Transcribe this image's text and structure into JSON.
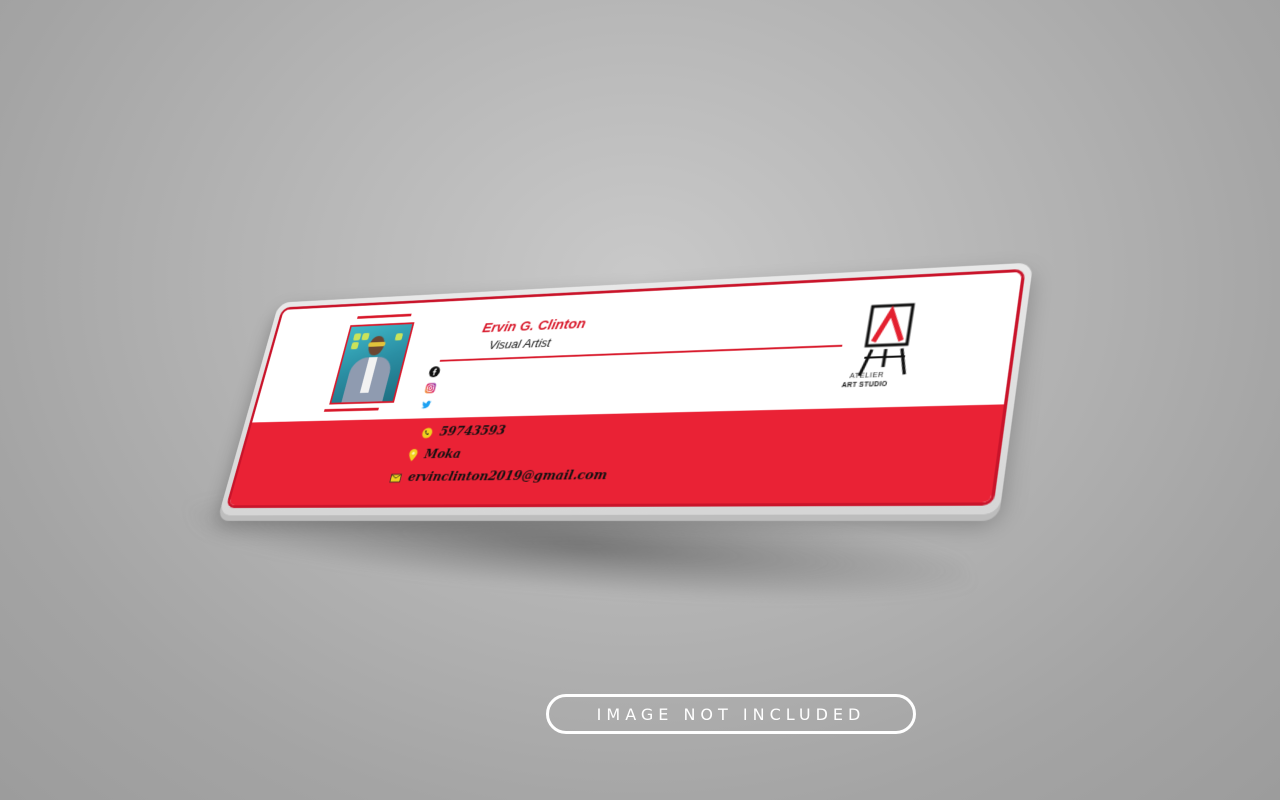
{
  "card": {
    "name": "Ervin G. Clinton",
    "role": "Visual Artist",
    "socials": [
      "facebook-icon",
      "instagram-icon",
      "twitter-icon"
    ],
    "contacts": {
      "phone": "59743593",
      "location": "Moka",
      "email": "ervinclinton2019@gmail.com"
    },
    "logo": {
      "name": "ATELIER",
      "subtitle": "ART STUDIO"
    }
  },
  "badge": {
    "label": "IMAGE NOT INCLUDED"
  },
  "colors": {
    "accent": "#ea2235",
    "background": "#b3b3b3",
    "card": "#ffffff"
  }
}
